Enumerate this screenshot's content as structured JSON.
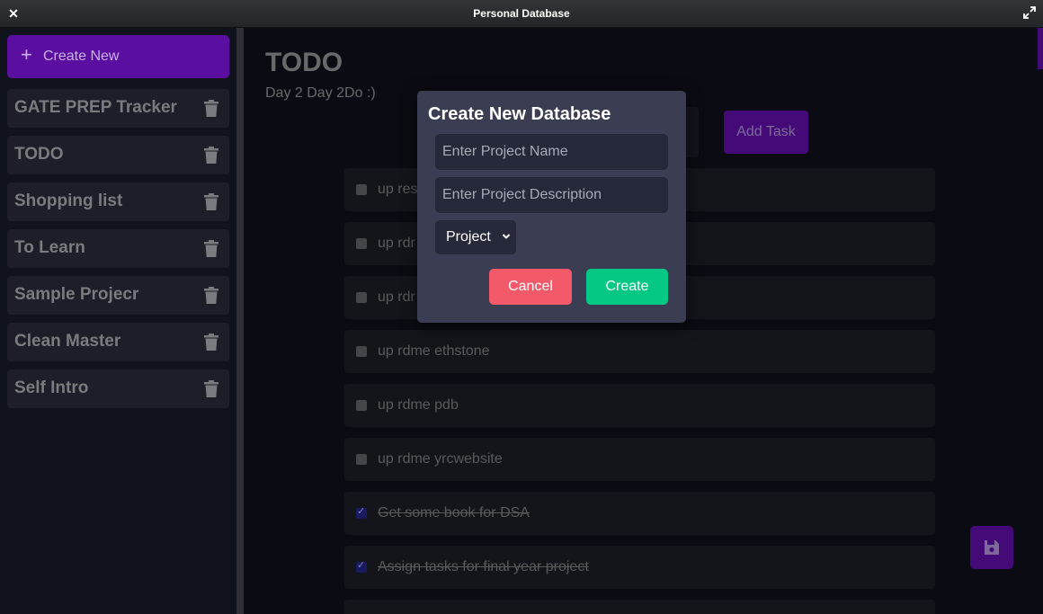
{
  "window": {
    "title": "Personal Database",
    "close_icon": "close-icon",
    "maximize_icon": "maximize-icon"
  },
  "sidebar": {
    "create_label": "Create New",
    "create_icon": "plus-icon",
    "items": [
      {
        "label": "GATE PREP Tracker"
      },
      {
        "label": "TODO"
      },
      {
        "label": "Shopping list"
      },
      {
        "label": "To Learn"
      },
      {
        "label": "Sample Projecr"
      },
      {
        "label": "Clean Master"
      },
      {
        "label": "Self Intro"
      }
    ],
    "delete_icon": "trash-icon"
  },
  "main": {
    "title": "TODO",
    "subtitle": "Day 2 Day 2Do :)",
    "add_task_label": "Add Task",
    "tasks": [
      {
        "text": "up res",
        "checked": false
      },
      {
        "text": "up rdr",
        "checked": false
      },
      {
        "text": "up rdr",
        "checked": false
      },
      {
        "text": "up rdme ethstone",
        "checked": false
      },
      {
        "text": "up rdme pdb",
        "checked": false
      },
      {
        "text": "up rdme yrcwebsite",
        "checked": false
      },
      {
        "text": "Get some book for DSA",
        "checked": true
      },
      {
        "text": "Assign tasks for final year project",
        "checked": true
      }
    ],
    "save_icon": "floppy-disk-icon"
  },
  "modal": {
    "title": "Create New Database",
    "name_placeholder": "Enter Project Name",
    "description_placeholder": "Enter Project Description",
    "type_selected": "Project",
    "cancel_label": "Cancel",
    "create_label": "Create"
  },
  "colors": {
    "accent": "#5b0fa0",
    "cancel": "#f35a69",
    "create": "#05c884",
    "modal_bg": "#3b3e52"
  }
}
